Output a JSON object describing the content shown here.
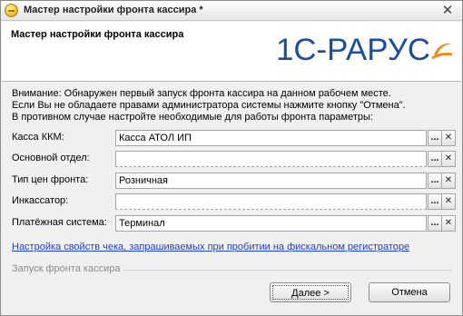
{
  "window": {
    "title": "Мастер настройки фронта кассира *",
    "close_glyph": "✕",
    "app_icon": "1c-app-icon"
  },
  "header": {
    "title": "Мастер настройки фронта кассира",
    "logo_text": "1С-РАРУС"
  },
  "notice": {
    "line1": "Внимание: Обнаружен первый запуск фронта кассира на данном рабочем месте.",
    "line2": "Если Вы не обладаете правами администратора системы нажмите кнопку \"Отмена\".",
    "line3": "В противном случае настройте необходимые для работы фронта параметры:"
  },
  "fields": [
    {
      "label": "Касса ККМ:",
      "value": "Касса АТОЛ ИП"
    },
    {
      "label": "Основной отдел:",
      "value": ""
    },
    {
      "label": "Тип цен фронта:",
      "value": "Розничная"
    },
    {
      "label": "Инкассатор:",
      "value": ""
    },
    {
      "label": "Платёжная система:",
      "value": "Терминал"
    }
  ],
  "field_buttons": {
    "select": "...",
    "clear": "✕"
  },
  "link_text": "Настройка свойств чека, запрашиваемых при пробитии на фискальном регистраторе",
  "group": {
    "label": "Запуск фронта кассира"
  },
  "buttons": {
    "next": "Далее >",
    "cancel": "Отмена"
  },
  "colors": {
    "logo_blue": "#1a4fa0",
    "logo_orange": "#f08a1c",
    "link": "#1f3fc7"
  }
}
